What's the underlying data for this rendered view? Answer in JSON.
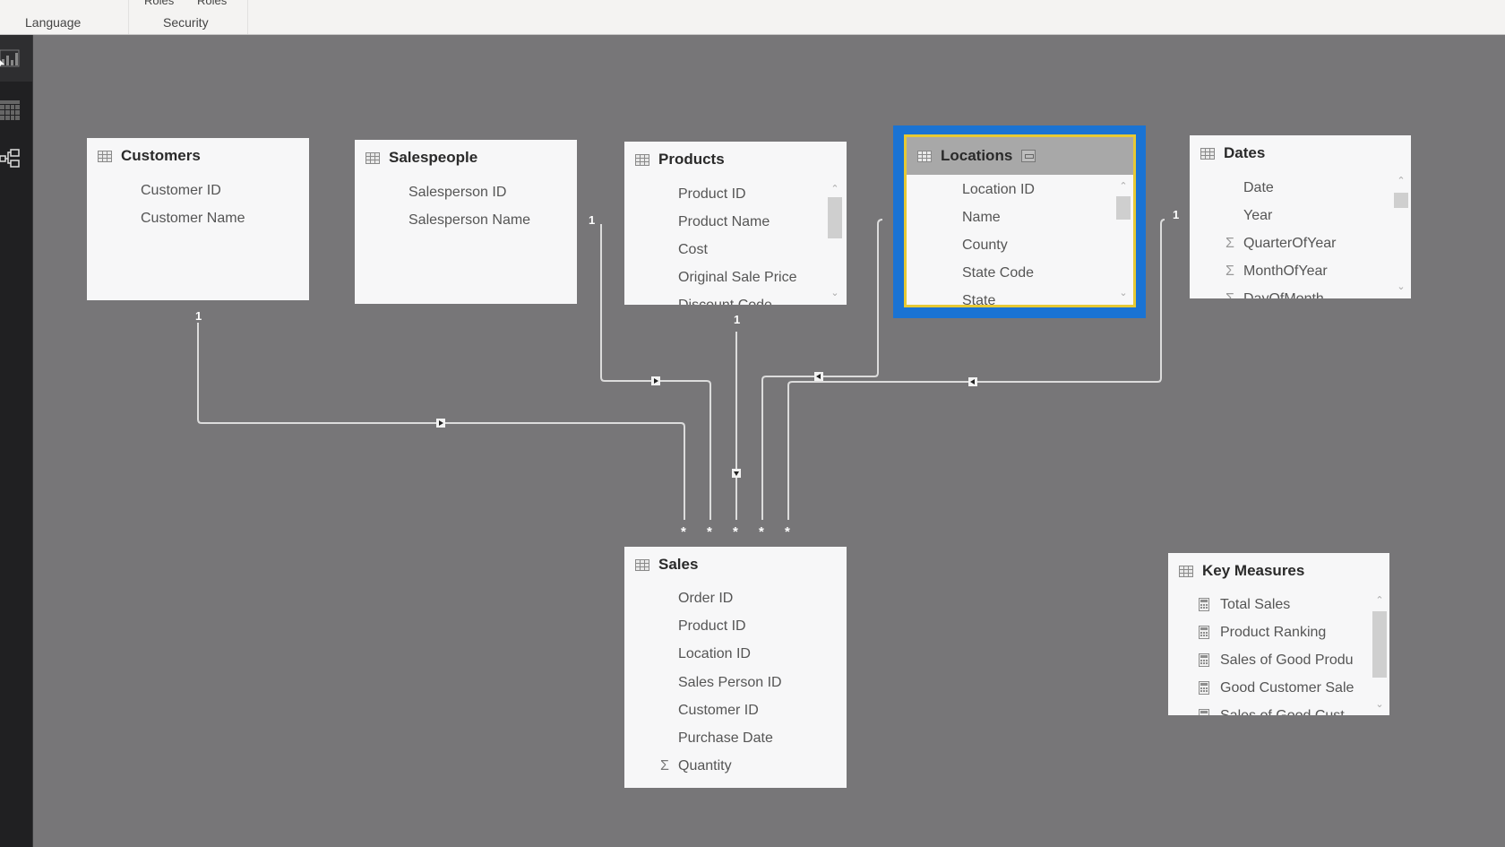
{
  "ribbon": {
    "groups": [
      {
        "label": "Language",
        "buttons": []
      },
      {
        "label": "Security",
        "buttons": [
          "Roles",
          "Roles"
        ]
      }
    ]
  },
  "left_rail": {
    "items": [
      {
        "name": "report-view",
        "icon": "bar-chart-icon",
        "active": true
      },
      {
        "name": "data-view",
        "icon": "table-grid-icon",
        "active": false
      },
      {
        "name": "relationships-view",
        "icon": "relationship-diagram-icon",
        "active": false
      }
    ]
  },
  "tables": {
    "customers": {
      "title": "Customers",
      "fields": [
        {
          "name": "Customer ID",
          "type": "text"
        },
        {
          "name": "Customer Name",
          "type": "text"
        }
      ]
    },
    "salespeople": {
      "title": "Salespeople",
      "fields": [
        {
          "name": "Salesperson ID",
          "type": "text"
        },
        {
          "name": "Salesperson Name",
          "type": "text"
        }
      ]
    },
    "products": {
      "title": "Products",
      "fields": [
        {
          "name": "Product ID",
          "type": "text"
        },
        {
          "name": "Product Name",
          "type": "text"
        },
        {
          "name": "Cost",
          "type": "text"
        },
        {
          "name": "Original Sale Price",
          "type": "text"
        },
        {
          "name": "Discount Code",
          "type": "text"
        }
      ]
    },
    "locations": {
      "title": "Locations",
      "selected": true,
      "fields": [
        {
          "name": "Location ID",
          "type": "text"
        },
        {
          "name": "Name",
          "type": "text"
        },
        {
          "name": "County",
          "type": "text"
        },
        {
          "name": "State Code",
          "type": "text"
        },
        {
          "name": "State",
          "type": "text"
        }
      ]
    },
    "dates": {
      "title": "Dates",
      "fields": [
        {
          "name": "Date",
          "type": "text"
        },
        {
          "name": "Year",
          "type": "text"
        },
        {
          "name": "QuarterOfYear",
          "type": "sum"
        },
        {
          "name": "MonthOfYear",
          "type": "sum"
        },
        {
          "name": "DayOfMonth",
          "type": "sum"
        }
      ]
    },
    "sales": {
      "title": "Sales",
      "fields": [
        {
          "name": "Order ID",
          "type": "text"
        },
        {
          "name": "Product ID",
          "type": "text"
        },
        {
          "name": "Location ID",
          "type": "text"
        },
        {
          "name": "Sales Person ID",
          "type": "text"
        },
        {
          "name": "Customer ID",
          "type": "text"
        },
        {
          "name": "Purchase Date",
          "type": "text"
        },
        {
          "name": "Quantity",
          "type": "sum"
        }
      ]
    },
    "key_measures": {
      "title": "Key Measures",
      "fields": [
        {
          "name": "Total Sales",
          "type": "measure"
        },
        {
          "name": "Product Ranking",
          "type": "measure"
        },
        {
          "name": "Sales of Good Produ",
          "type": "measure"
        },
        {
          "name": "Good Customer Sale",
          "type": "measure"
        },
        {
          "name": "Sales of Good Cust",
          "type": "measure"
        }
      ]
    }
  },
  "relationships": [
    {
      "from": "Customers",
      "to": "Sales",
      "from_card": "1",
      "to_card": "*"
    },
    {
      "from": "Salespeople",
      "to": "Sales",
      "from_card": "1",
      "to_card": "*"
    },
    {
      "from": "Products",
      "to": "Sales",
      "from_card": "1",
      "to_card": "*"
    },
    {
      "from": "Locations",
      "to": "Sales",
      "from_card": "1",
      "to_card": "*"
    },
    {
      "from": "Dates",
      "to": "Sales",
      "from_card": "1",
      "to_card": "*"
    }
  ],
  "cardinality": {
    "one": "1",
    "many": "*"
  },
  "colors": {
    "selection_outer": "#1a73d3",
    "selection_inner": "#e7c934",
    "canvas": "#777678"
  }
}
